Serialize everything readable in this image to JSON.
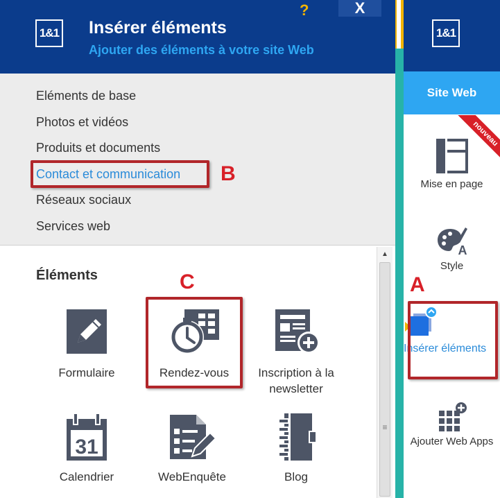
{
  "header": {
    "logo": "1&1",
    "title": "Insérer éléments",
    "subtitle": "Ajouter des éléments à votre site Web",
    "help_label": "?",
    "close_label": "X"
  },
  "categories": [
    {
      "label": "Eléments de base"
    },
    {
      "label": "Photos et vidéos"
    },
    {
      "label": "Produits et documents"
    },
    {
      "label": "Contact et communication",
      "active": true
    },
    {
      "label": "Réseaux sociaux"
    },
    {
      "label": "Services web"
    }
  ],
  "elements_section": {
    "title": "Éléments",
    "items": [
      {
        "label": "Formulaire",
        "icon": "form-pencil-icon"
      },
      {
        "label": "Rendez-vous",
        "icon": "appointment-clock-icon"
      },
      {
        "label": "Inscription à la newsletter",
        "icon": "newsletter-add-icon"
      },
      {
        "label": "Calendrier",
        "icon": "calendar-icon",
        "day": "31"
      },
      {
        "label": "WebEnquête",
        "icon": "survey-icon"
      },
      {
        "label": "Blog",
        "icon": "blog-notebook-icon"
      }
    ]
  },
  "sidebar": {
    "logo": "1&1",
    "site_label": "Site Web",
    "badge": "nouveau",
    "items": [
      {
        "label": "Mise en page",
        "icon": "layout-icon"
      },
      {
        "label": "Style",
        "icon": "palette-icon"
      },
      {
        "label": "Insérer éléments",
        "icon": "insert-elements-icon",
        "active": true
      },
      {
        "label": "Ajouter Web Apps",
        "icon": "web-apps-icon"
      }
    ]
  },
  "annotations": {
    "a": "A",
    "b": "B",
    "c": "C"
  },
  "colors": {
    "header_bg": "#0b3c8c",
    "accent_blue": "#2ea6f2",
    "annotation_red": "#d82028",
    "icon_gray": "#4d5566"
  }
}
